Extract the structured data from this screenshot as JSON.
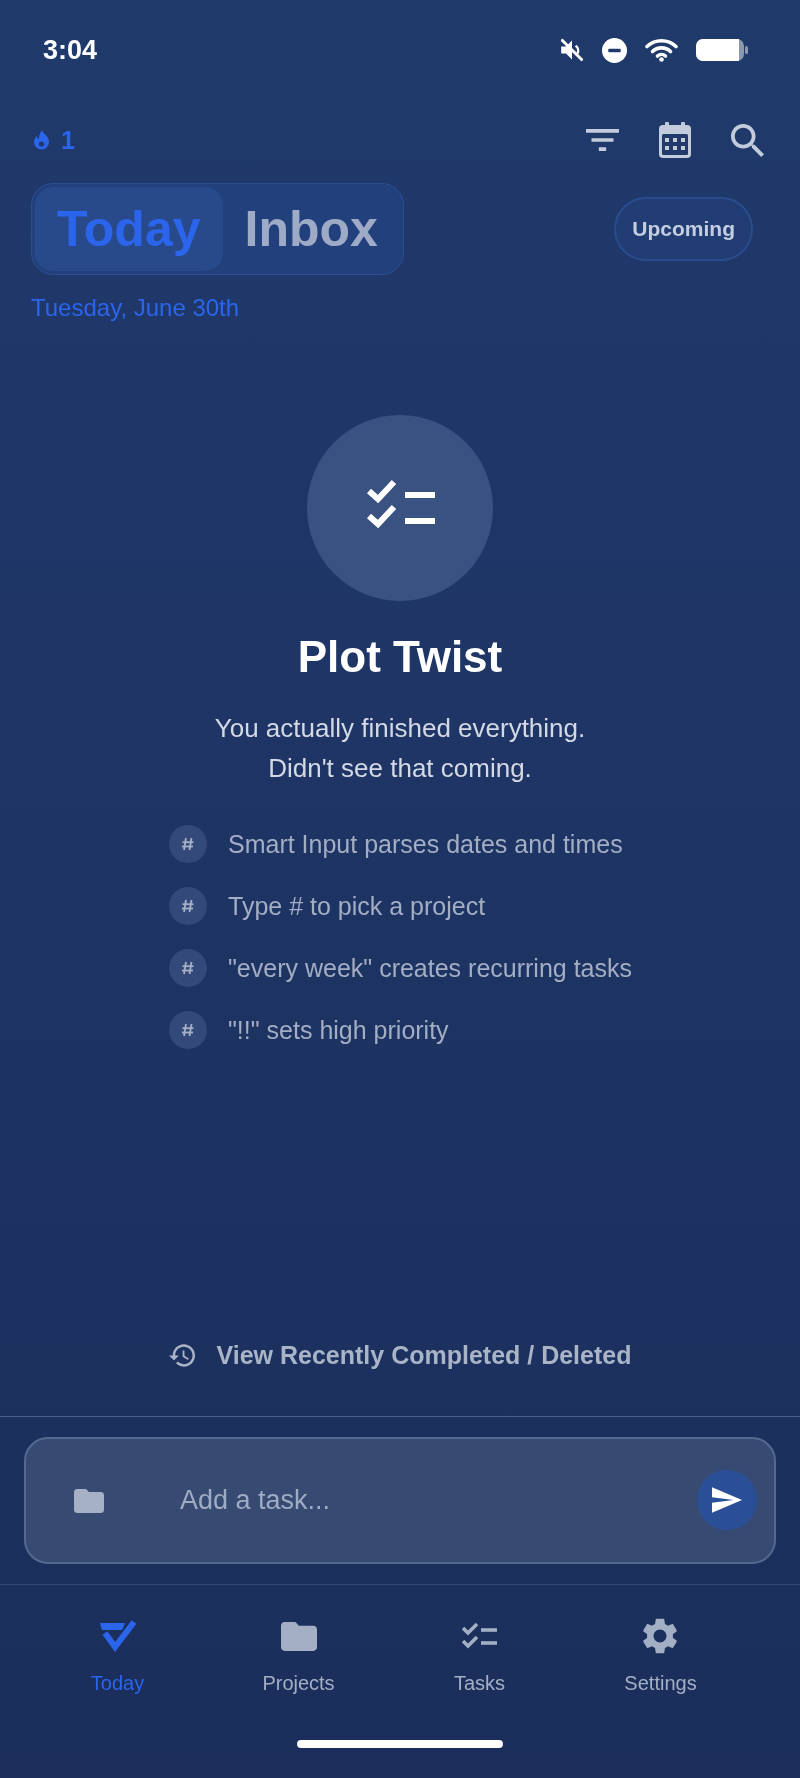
{
  "status_bar": {
    "time": "3:04"
  },
  "header": {
    "streak": "1",
    "segments": [
      {
        "label": "Today",
        "selected": true
      },
      {
        "label": "Inbox",
        "selected": false
      }
    ],
    "upcoming_button": "Upcoming",
    "date": "Tuesday, June 30th"
  },
  "empty_state": {
    "title": "Plot Twist",
    "message": "You actually finished everything. Didn't see that coming.",
    "tips": [
      "Smart Input parses dates and times",
      "Type # to pick a project",
      "\"every week\" creates recurring tasks",
      "\"!!\" sets high priority"
    ]
  },
  "recent_link": "View Recently Completed / Deleted",
  "task_input": {
    "placeholder": "Add a task..."
  },
  "bottom_nav": [
    {
      "label": "Today",
      "selected": true
    },
    {
      "label": "Projects",
      "selected": false
    },
    {
      "label": "Tasks",
      "selected": false
    },
    {
      "label": "Settings",
      "selected": false
    }
  ]
}
